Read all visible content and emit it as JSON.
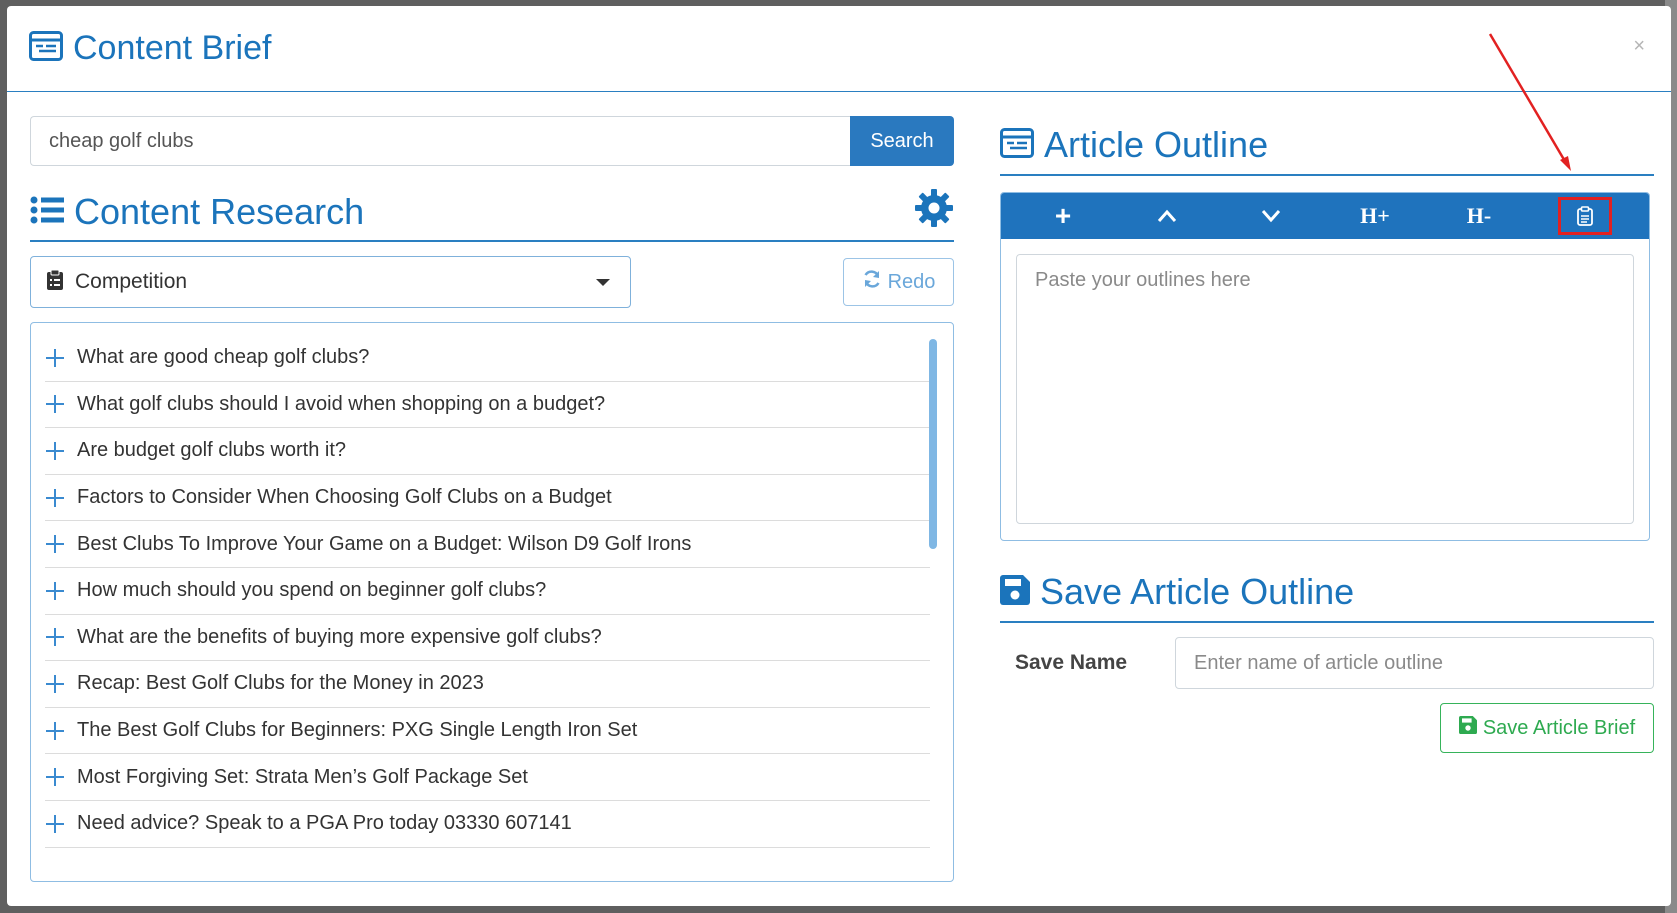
{
  "modal": {
    "title": "Content Brief",
    "close_label": "×"
  },
  "search": {
    "value": "cheap golf clubs",
    "button_label": "Search"
  },
  "research": {
    "title": "Content Research",
    "select_value": "Competition",
    "redo_label": "Redo",
    "items": [
      "What are good cheap golf clubs?",
      "What golf clubs should I avoid when shopping on a budget?",
      "Are budget golf clubs worth it?",
      "Factors to Consider When Choosing Golf Clubs on a Budget",
      "Best Clubs To Improve Your Game on a Budget: Wilson D9 Golf Irons",
      "How much should you spend on beginner golf clubs?",
      "What are the benefits of buying more expensive golf clubs?",
      "Recap: Best Golf Clubs for the Money in 2023",
      "The Best Golf Clubs for Beginners: PXG Single Length Iron Set",
      "Most Forgiving Set: Strata Men’s Golf Package Set",
      "Need advice? Speak to a PGA Pro today 03330 607141"
    ]
  },
  "outline": {
    "title": "Article Outline",
    "toolbar": {
      "add_label": "+",
      "heading_up_label": "H+",
      "heading_down_label": "H-"
    },
    "placeholder": "Paste your outlines here"
  },
  "save": {
    "title": "Save Article Outline",
    "name_label": "Save Name",
    "name_placeholder": "Enter name of article outline",
    "button_label": "Save Article Brief"
  },
  "colors": {
    "primary": "#1b74bb",
    "toolbar": "#1f73bd",
    "success": "#2eaa50",
    "highlight": "#e22121"
  }
}
